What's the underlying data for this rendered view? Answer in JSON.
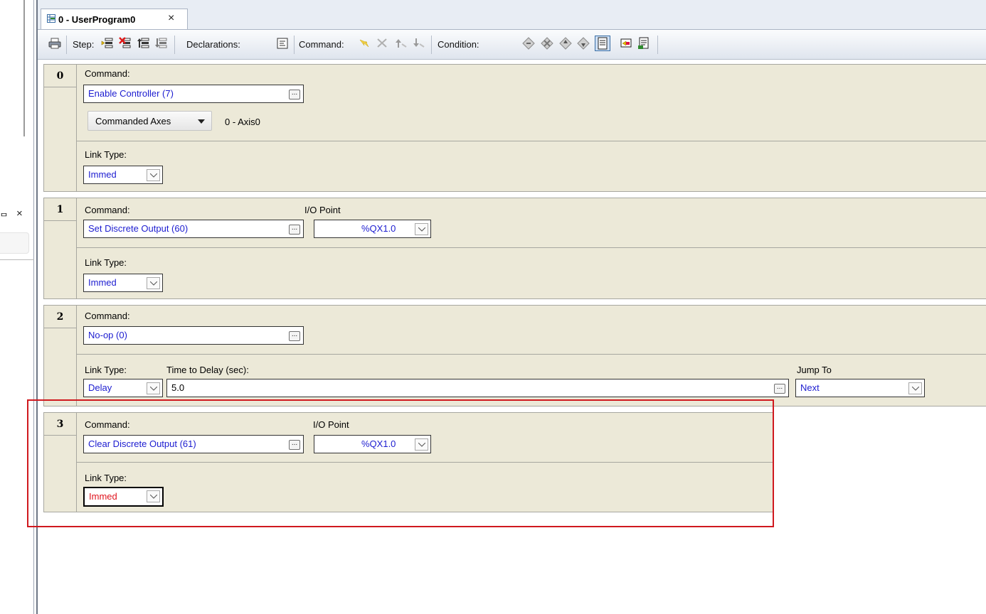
{
  "tab": {
    "title": "0 - UserProgram0",
    "close": "×"
  },
  "left_panel": {
    "pin": "ᄆ",
    "close": "×"
  },
  "toolbar": {
    "step_label": "Step:",
    "declarations_label": "Declarations:",
    "command_label": "Command:",
    "condition_label": "Condition:"
  },
  "labels": {
    "command": "Command:",
    "link_type": "Link Type:",
    "io_point": "I/O Point",
    "time_to_delay": "Time to Delay (sec):",
    "jump_to": "Jump To",
    "ellipsis": "..."
  },
  "steps": [
    {
      "number": "0",
      "command": "Enable Controller (7)",
      "commanded_axes_label": "Commanded Axes",
      "axes_value": "0 - Axis0",
      "link_type": "Immed"
    },
    {
      "number": "1",
      "command": "Set Discrete Output (60)",
      "io_point": "%QX1.0",
      "link_type": "Immed"
    },
    {
      "number": "2",
      "command": "No-op (0)",
      "link_type": "Delay",
      "time_to_delay": "5.0",
      "jump_to": "Next"
    },
    {
      "number": "3",
      "command": "Clear Discrete Output (61)",
      "io_point": "%QX1.0",
      "link_type": "Immed"
    }
  ],
  "colors": {
    "value_text": "#1c1cd0",
    "error_text": "#e0141e",
    "highlight": "#d0191e",
    "step_bg": "#ece9d8"
  }
}
